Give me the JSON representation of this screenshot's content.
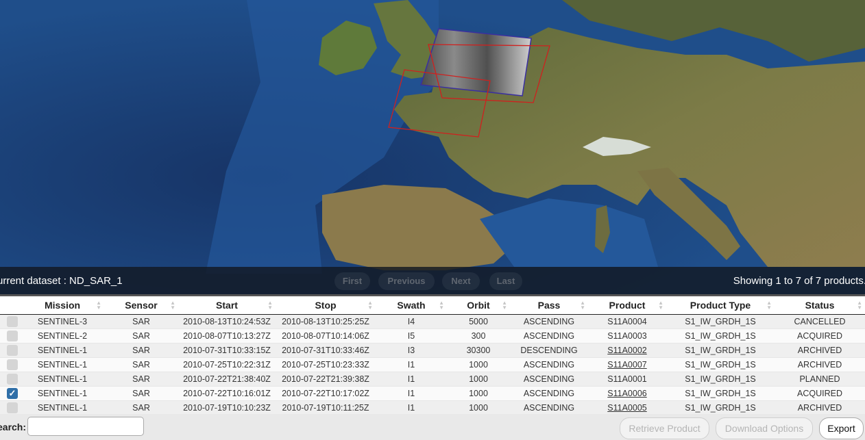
{
  "pager": {
    "dataset_label": "urrent dataset : ND_SAR_1",
    "first": "First",
    "previous": "Previous",
    "next": "Next",
    "last": "Last",
    "showing": "Showing 1 to 7 of 7 products."
  },
  "table": {
    "columns": [
      "Mission",
      "Sensor",
      "Start",
      "Stop",
      "Swath",
      "Orbit",
      "Pass",
      "Product",
      "Product Type",
      "Status"
    ],
    "rows": [
      {
        "checked": false,
        "mission": "SENTINEL-3",
        "sensor": "SAR",
        "start": "2010-08-13T10:24:53Z",
        "stop": "2010-08-13T10:25:25Z",
        "swath": "I4",
        "orbit": "5000",
        "pass": "ASCENDING",
        "product": "S11A0004",
        "product_link": false,
        "product_type": "S1_IW_GRDH_1S",
        "status": "CANCELLED"
      },
      {
        "checked": false,
        "mission": "SENTINEL-2",
        "sensor": "SAR",
        "start": "2010-08-07T10:13:27Z",
        "stop": "2010-08-07T10:14:06Z",
        "swath": "I5",
        "orbit": "300",
        "pass": "ASCENDING",
        "product": "S11A0003",
        "product_link": false,
        "product_type": "S1_IW_GRDH_1S",
        "status": "ACQUIRED"
      },
      {
        "checked": false,
        "mission": "SENTINEL-1",
        "sensor": "SAR",
        "start": "2010-07-31T10:33:15Z",
        "stop": "2010-07-31T10:33:46Z",
        "swath": "I3",
        "orbit": "30300",
        "pass": "DESCENDING",
        "product": "S11A0002",
        "product_link": true,
        "product_type": "S1_IW_GRDH_1S",
        "status": "ARCHIVED"
      },
      {
        "checked": false,
        "mission": "SENTINEL-1",
        "sensor": "SAR",
        "start": "2010-07-25T10:22:31Z",
        "stop": "2010-07-25T10:23:33Z",
        "swath": "I1",
        "orbit": "1000",
        "pass": "ASCENDING",
        "product": "S11A0007",
        "product_link": true,
        "product_type": "S1_IW_GRDH_1S",
        "status": "ARCHIVED"
      },
      {
        "checked": false,
        "mission": "SENTINEL-1",
        "sensor": "SAR",
        "start": "2010-07-22T21:38:40Z",
        "stop": "2010-07-22T21:39:38Z",
        "swath": "I1",
        "orbit": "1000",
        "pass": "ASCENDING",
        "product": "S11A0001",
        "product_link": false,
        "product_type": "S1_IW_GRDH_1S",
        "status": "PLANNED"
      },
      {
        "checked": true,
        "mission": "SENTINEL-1",
        "sensor": "SAR",
        "start": "2010-07-22T10:16:01Z",
        "stop": "2010-07-22T10:17:02Z",
        "swath": "I1",
        "orbit": "1000",
        "pass": "ASCENDING",
        "product": "S11A0006",
        "product_link": true,
        "product_type": "S1_IW_GRDH_1S",
        "status": "ACQUIRED"
      },
      {
        "checked": false,
        "mission": "SENTINEL-1",
        "sensor": "SAR",
        "start": "2010-07-19T10:10:23Z",
        "stop": "2010-07-19T10:11:25Z",
        "swath": "I1",
        "orbit": "1000",
        "pass": "ASCENDING",
        "product": "S11A0005",
        "product_link": true,
        "product_type": "S1_IW_GRDH_1S",
        "status": "ARCHIVED"
      }
    ]
  },
  "footer": {
    "search_label": "earch:",
    "search_value": "",
    "retrieve": "Retrieve Product",
    "download": "Download Options",
    "export": "Export"
  },
  "colors": {
    "footprint": "#d0201e",
    "checkbox_checked": "#2f6fa8",
    "ocean": "#1b4277",
    "land": "#7d7a48"
  }
}
